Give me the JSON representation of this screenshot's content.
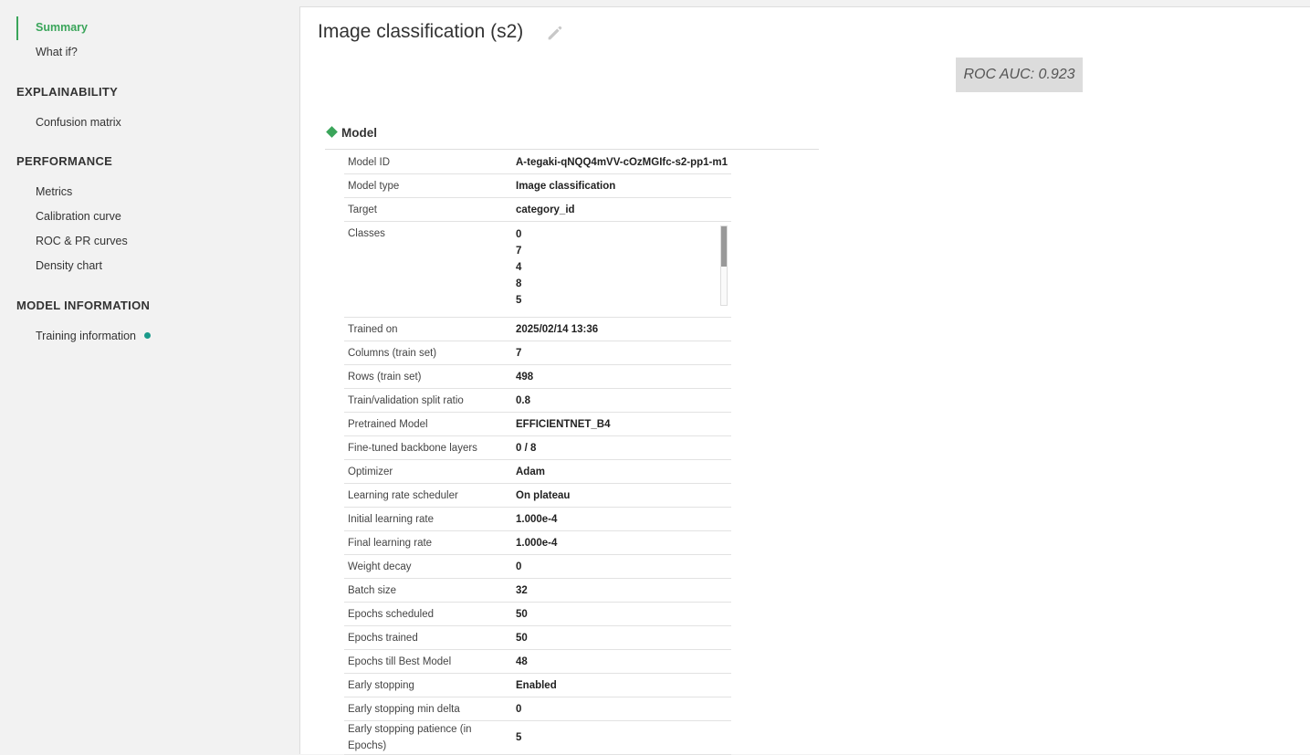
{
  "sidebar": {
    "summary": "Summary",
    "what_if": "What if?",
    "sections": {
      "explainability": "EXPLAINABILITY",
      "performance": "PERFORMANCE",
      "model_information": "MODEL INFORMATION"
    },
    "confusion_matrix": "Confusion matrix",
    "metrics": "Metrics",
    "calibration_curve": "Calibration curve",
    "roc_pr_curves": "ROC & PR curves",
    "density_chart": "Density chart",
    "training_information": "Training information"
  },
  "main": {
    "title": "Image classification (s2)",
    "roc_auc": "ROC AUC: 0.923",
    "model_section_label": "Model",
    "rows": [
      {
        "key": "Model ID",
        "value": "A-tegaki-qNQQ4mVV-cOzMGIfc-s2-pp1-m1"
      },
      {
        "key": "Model type",
        "value": "Image classification"
      },
      {
        "key": "Target",
        "value": "category_id"
      },
      {
        "key": "Classes",
        "values": [
          "0",
          "7",
          "4",
          "8",
          "5"
        ]
      },
      {
        "key": "Trained on",
        "value": "2025/02/14 13:36"
      },
      {
        "key": "Columns (train set)",
        "value": "7"
      },
      {
        "key": "Rows (train set)",
        "value": "498"
      },
      {
        "key": "Train/validation split ratio",
        "value": "0.8"
      },
      {
        "key": "Pretrained Model",
        "value": "EFFICIENTNET_B4"
      },
      {
        "key": "Fine-tuned backbone layers",
        "value": "0 / 8"
      },
      {
        "key": "Optimizer",
        "value": "Adam"
      },
      {
        "key": "Learning rate scheduler",
        "value": "On plateau"
      },
      {
        "key": "Initial learning rate",
        "value": "1.000e-4"
      },
      {
        "key": "Final learning rate",
        "value": "1.000e-4"
      },
      {
        "key": "Weight decay",
        "value": "0"
      },
      {
        "key": "Batch size",
        "value": "32"
      },
      {
        "key": "Epochs scheduled",
        "value": "50"
      },
      {
        "key": "Epochs trained",
        "value": "50"
      },
      {
        "key": "Epochs till Best Model",
        "value": "48"
      },
      {
        "key": "Early stopping",
        "value": "Enabled"
      },
      {
        "key": "Early stopping min delta",
        "value": "0"
      },
      {
        "key": "Early stopping patience (in Epochs)",
        "value": "5"
      }
    ]
  },
  "colors": {
    "accent": "#3aa55a",
    "status_dot": "#1a9a8a",
    "roc_box": "#dcdcdc"
  },
  "icons": [
    "edit-pencil-icon",
    "model-diamond-icon",
    "status-dot-icon"
  ]
}
